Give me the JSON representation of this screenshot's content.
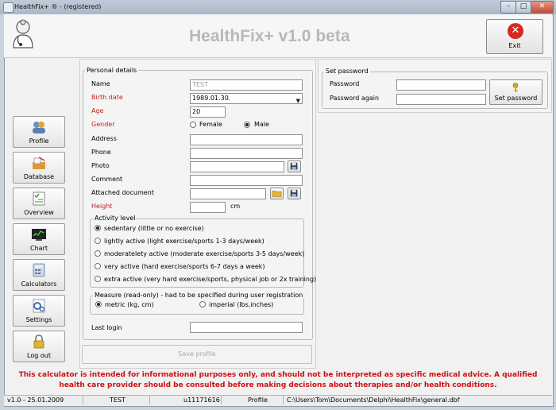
{
  "window": {
    "title": "HealthFix+ ® - (registered)",
    "controls": [
      "–",
      "□",
      "✕"
    ]
  },
  "header": {
    "app_title": "HealthFix+ v1.0 beta",
    "exit_label": "Exit"
  },
  "sidebar": {
    "items": [
      {
        "label": "Profile",
        "icon": "profile-icon"
      },
      {
        "label": "Database",
        "icon": "database-icon"
      },
      {
        "label": "Overview",
        "icon": "overview-icon"
      },
      {
        "label": "Chart",
        "icon": "chart-icon"
      },
      {
        "label": "Calculators",
        "icon": "calculator-icon"
      },
      {
        "label": "Settings",
        "icon": "settings-icon"
      },
      {
        "label": "Log out",
        "icon": "lock-icon"
      }
    ]
  },
  "personal": {
    "group_title": "Personal details",
    "name_label": "Name",
    "name_value": "TEST",
    "birth_label": "Birth date",
    "birth_value": "1989.01.30.",
    "age_label": "Age",
    "age_value": "20",
    "gender_label": "Gender",
    "gender_female": "Female",
    "gender_male": "Male",
    "gender_selected": "Male",
    "address_label": "Address",
    "phone_label": "Phone",
    "photo_label": "Photo",
    "comment_label": "Comment",
    "attached_label": "Attached document",
    "height_label": "Height",
    "height_unit": "cm",
    "activity_title": "Activity level",
    "activity_options": [
      "sedentary (little or no exercise)",
      "lightly active (light exercise/sports 1-3 days/week)",
      "moderatelety active (moderate exercise/sports 3-5 days/week)",
      "very active (hard exercise/sports 6-7 days a week)",
      "extra active (very hard exercise/sports, physical job or 2x training)"
    ],
    "activity_selected": 0,
    "measure_title": "Measure (read-only) - had to be specified during user registration",
    "measure_metric": "metric (kg, cm)",
    "measure_imperial": "imperial (lbs,inches)",
    "measure_selected": "metric",
    "last_login_label": "Last login",
    "save_label": "Save profile"
  },
  "password": {
    "group_title": "Set password",
    "password_label": "Password",
    "password_again_label": "Password again",
    "set_button_label": "Set password"
  },
  "disclaimer": "This calculator is intended for informational purposes only, and should not be interpreted as specific medical advice. A qualified health care provider should be consulted before making decisions about therapies and/or health conditions.",
  "statusbar": {
    "version": "v1.0 - 25.01.2009",
    "user": "TEST",
    "user_id": "u11171616",
    "view": "Profile",
    "path": "C:\\Users\\Tom\\Documents\\Delphi\\HealthFix\\general.dbf"
  },
  "colors": {
    "required_label": "#c41f1f",
    "disclaimer": "#d01010",
    "title_text": "#b8b8b8"
  }
}
